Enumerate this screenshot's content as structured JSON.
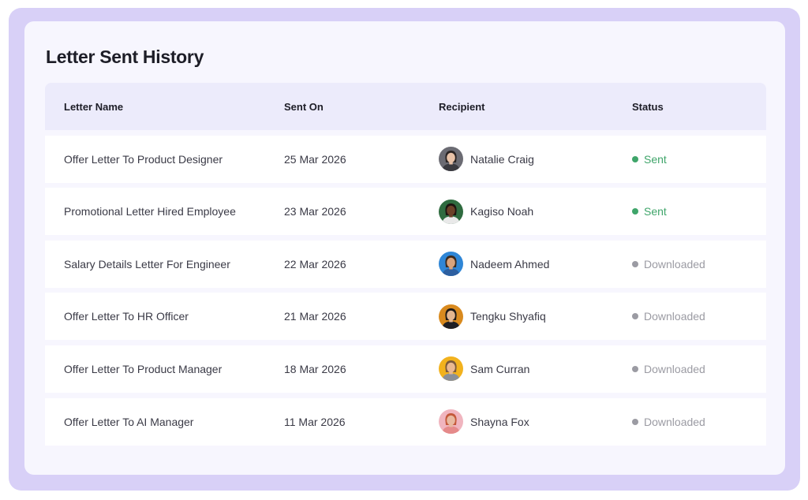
{
  "page": {
    "title": "Letter Sent History"
  },
  "table": {
    "headers": {
      "letter_name": "Letter Name",
      "sent_on": "Sent On",
      "recipient": "Recipient",
      "status": "Status"
    },
    "rows": [
      {
        "letter_name": "Offer Letter To Product Designer",
        "sent_on": "25 Mar 2026",
        "recipient": "Natalie Craig",
        "status": "Sent",
        "avatar_bg": "#6b6b73",
        "skin": "#e8c2a8",
        "hair": "#2a2424",
        "shirt": "#3a3a40"
      },
      {
        "letter_name": "Promotional Letter Hired Employee",
        "sent_on": "23 Mar 2026",
        "recipient": "Kagiso Noah",
        "status": "Sent",
        "avatar_bg": "#2f6b3f",
        "skin": "#6b4128",
        "hair": "#1c1410",
        "shirt": "#e9e9e9"
      },
      {
        "letter_name": "Salary Details Letter For Engineer",
        "sent_on": "22 Mar 2026",
        "recipient": "Nadeem Ahmed",
        "status": "Downloaded",
        "avatar_bg": "#2f86d6",
        "skin": "#d9a37c",
        "hair": "#3b2a1e",
        "shirt": "#2d5fa0"
      },
      {
        "letter_name": "Offer Letter To HR Officer",
        "sent_on": "21 Mar 2026",
        "recipient": "Tengku Shyafiq",
        "status": "Downloaded",
        "avatar_bg": "#d98a1e",
        "skin": "#e3b690",
        "hair": "#1e1a18",
        "shirt": "#1f1f24"
      },
      {
        "letter_name": "Offer Letter To Product Manager",
        "sent_on": "18 Mar 2026",
        "recipient": "Sam Curran",
        "status": "Downloaded",
        "avatar_bg": "#f2b21e",
        "skin": "#e9b892",
        "hair": "#7a5a3c",
        "shirt": "#8a8f98"
      },
      {
        "letter_name": "Offer Letter To AI Manager",
        "sent_on": "11 Mar 2026",
        "recipient": "Shayna Fox",
        "status": "Downloaded",
        "avatar_bg": "#f0b5bf",
        "skin": "#e8b9a0",
        "hair": "#c4583a",
        "shirt": "#e58a8a"
      }
    ]
  },
  "colors": {
    "sent": "#3fa56a",
    "downloaded": "#9b9ba3",
    "frame": "#d8d0f7",
    "card": "#f7f6fe",
    "header_bg": "#ecebfb"
  }
}
